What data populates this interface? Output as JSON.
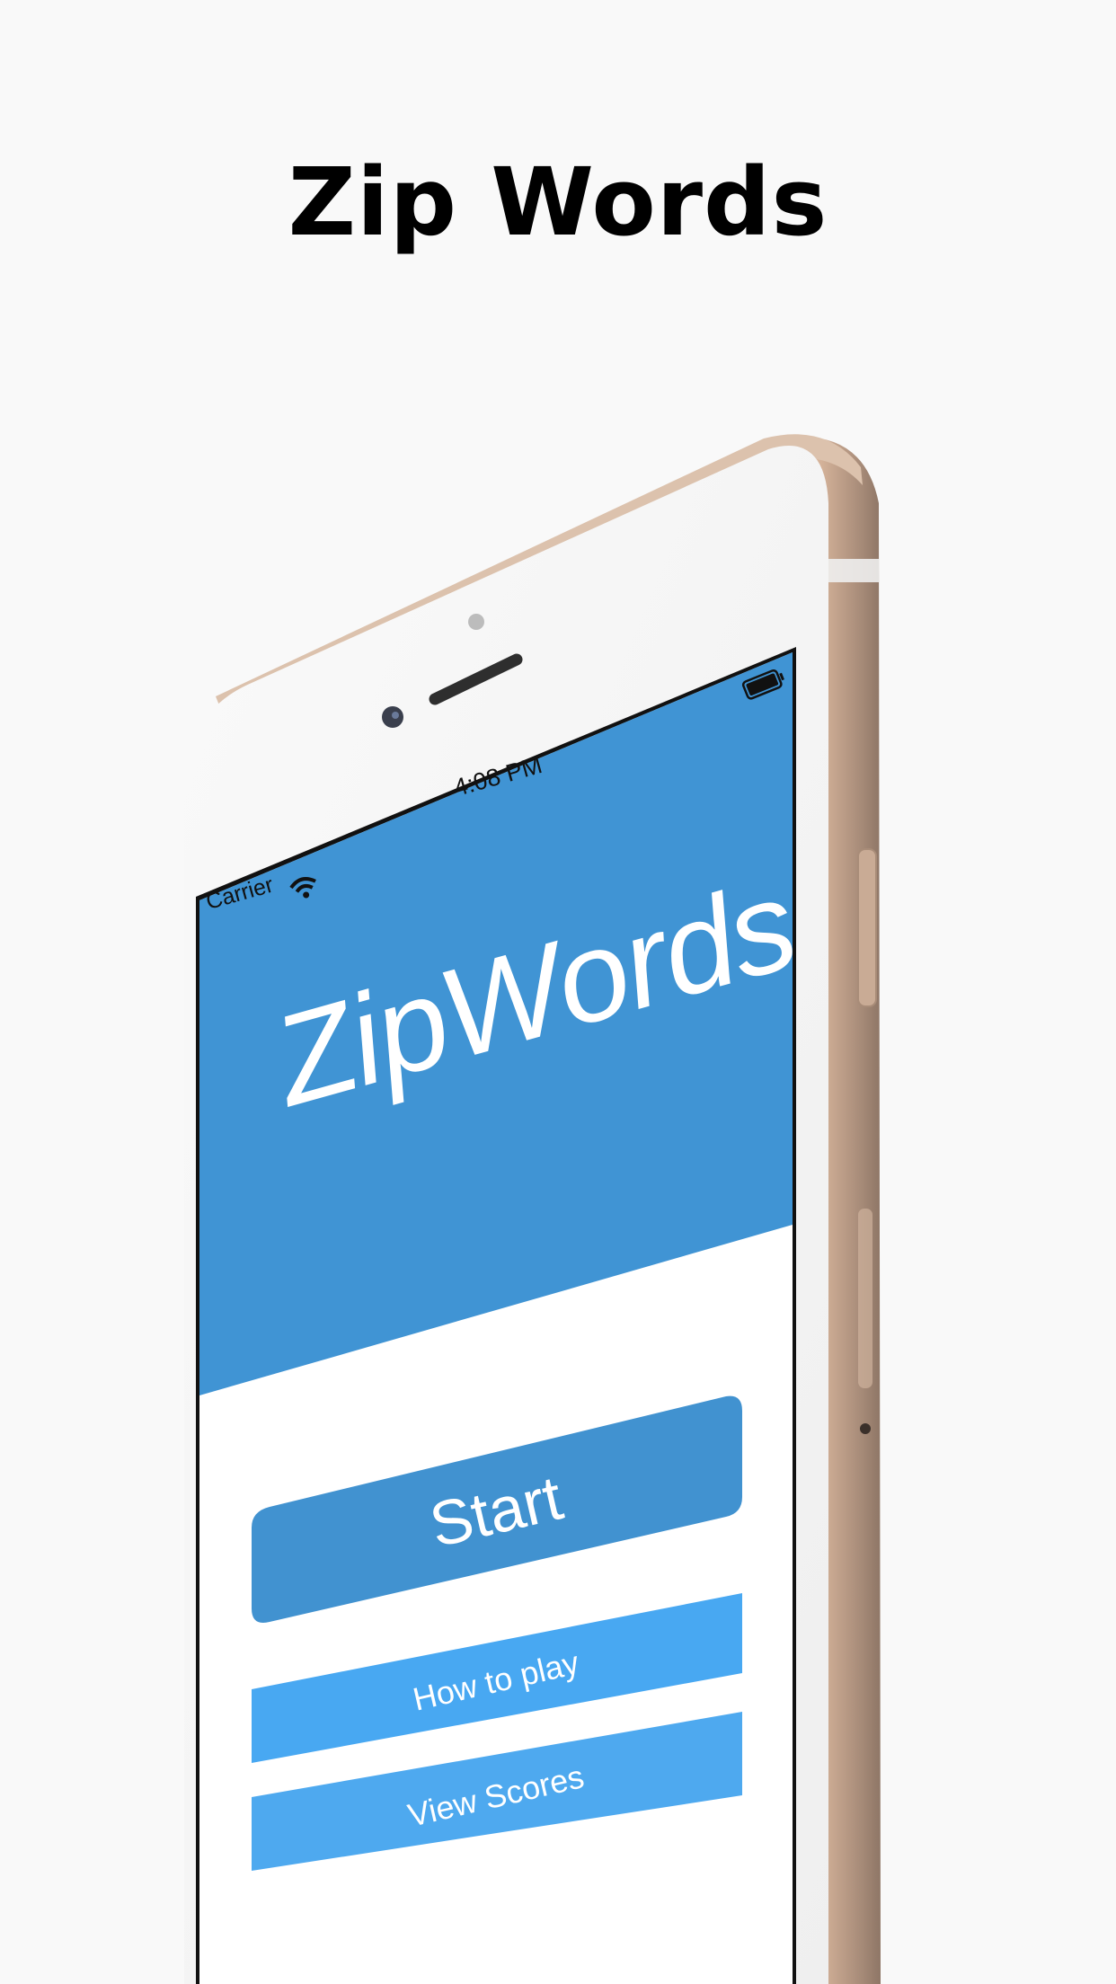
{
  "page": {
    "headline": "Zip Words",
    "background_color": "#f9f9f9"
  },
  "device": {
    "frame_color": "#d9bda6",
    "bezel_color": "#f4f4f4"
  },
  "status_bar": {
    "carrier": "Carrier",
    "time": "4:08 PM",
    "icons": [
      "wifi-icon",
      "battery-icon"
    ]
  },
  "app": {
    "logo_text": "ZipWords",
    "header_color": "#4094d4",
    "buttons": {
      "start": {
        "label": "Start",
        "color": "#4192d0"
      },
      "how_to_play": {
        "label": "How to play",
        "color": "#48a8f2"
      },
      "view_scores": {
        "label": "View Scores",
        "color": "#4ea9ef"
      }
    }
  }
}
